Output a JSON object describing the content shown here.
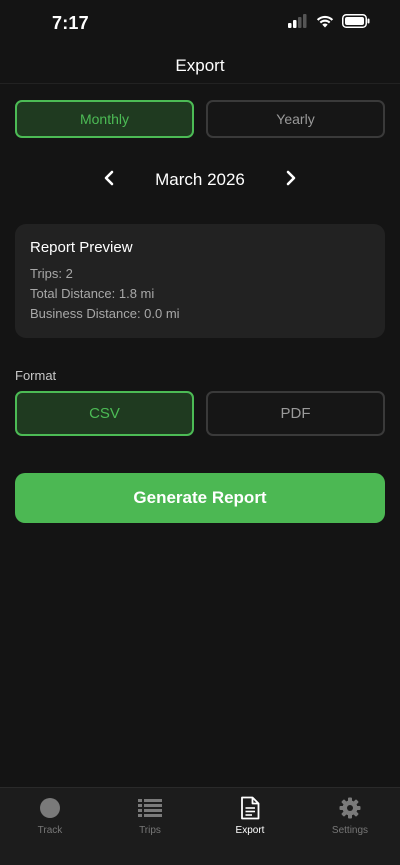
{
  "status_bar": {
    "time": "7:17"
  },
  "header": {
    "title": "Export"
  },
  "period_toggle": {
    "options": [
      {
        "label": "Monthly",
        "selected": true
      },
      {
        "label": "Yearly",
        "selected": false
      }
    ]
  },
  "period": {
    "label": "March 2026"
  },
  "preview": {
    "title": "Report Preview",
    "trips": "Trips: 2",
    "total_distance": "Total Distance: 1.8 mi",
    "business_distance": "Business Distance: 0.0 mi"
  },
  "format": {
    "label": "Format",
    "options": [
      {
        "label": "CSV",
        "selected": true
      },
      {
        "label": "PDF",
        "selected": false
      }
    ]
  },
  "generate_button": {
    "label": "Generate Report"
  },
  "tabs": [
    {
      "label": "Track",
      "icon": "circle-icon",
      "active": false
    },
    {
      "label": "Trips",
      "icon": "list-icon",
      "active": false
    },
    {
      "label": "Export",
      "icon": "document-icon",
      "active": true
    },
    {
      "label": "Settings",
      "icon": "gear-icon",
      "active": false
    }
  ],
  "colors": {
    "accent": "#4cb853",
    "background": "#141414",
    "card": "#222222",
    "selected_fill": "#1f3a20"
  }
}
